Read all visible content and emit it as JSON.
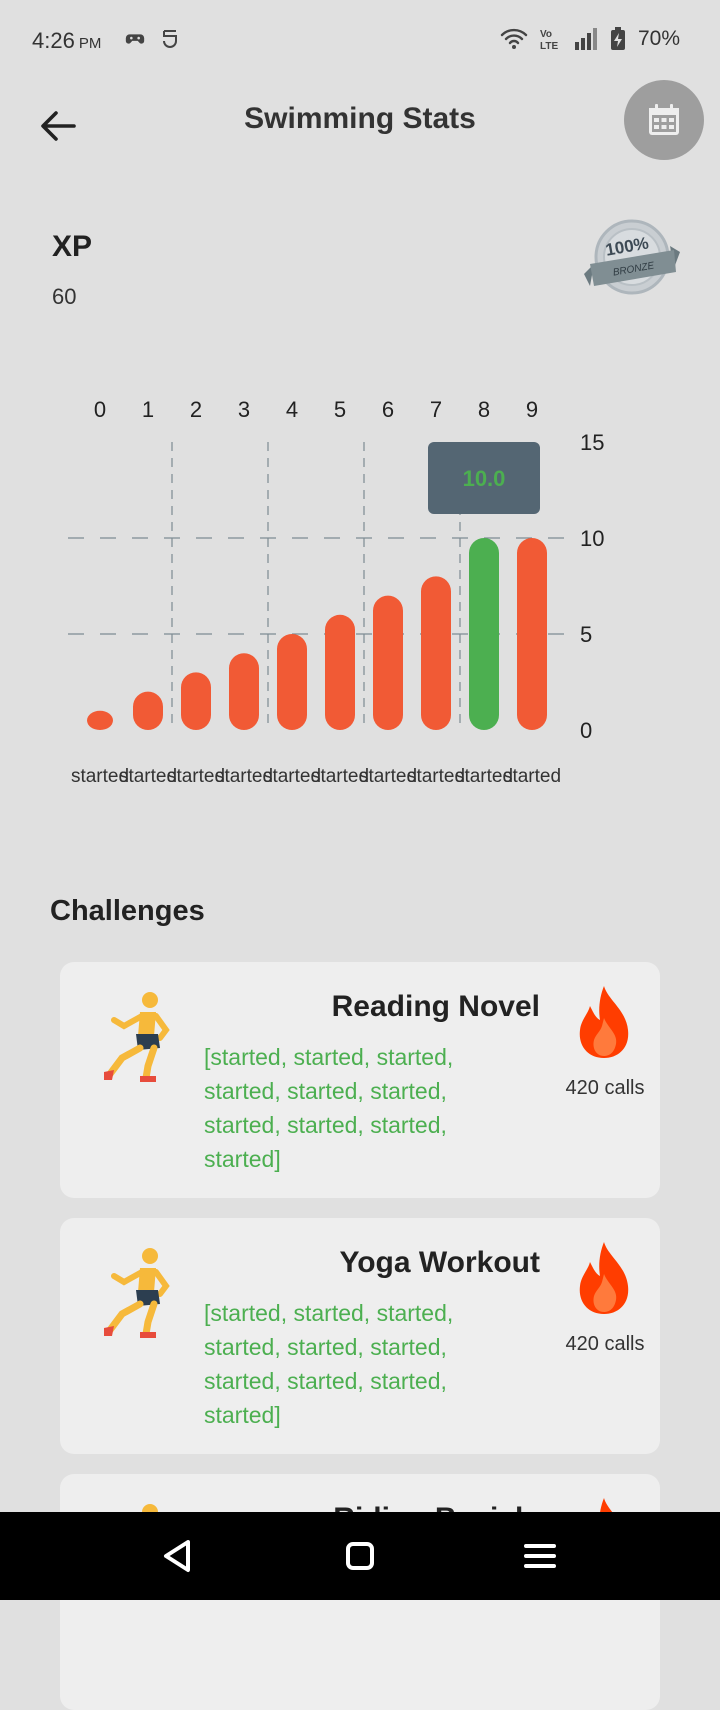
{
  "status": {
    "time": "4:26",
    "ampm": "PM",
    "battery": "70%"
  },
  "header": {
    "title": "Swimming Stats"
  },
  "xp": {
    "label": "XP",
    "value": "60"
  },
  "badge": {
    "top_text": "100%",
    "ribbon_text": "BRONZE"
  },
  "chart_data": {
    "type": "bar",
    "top_labels": [
      "0",
      "1",
      "2",
      "3",
      "4",
      "5",
      "6",
      "7",
      "8",
      "9"
    ],
    "categories": [
      "started",
      "started",
      "started",
      "started",
      "started",
      "started",
      "started",
      "started",
      "started",
      "started"
    ],
    "values": [
      1,
      2,
      3,
      4,
      5,
      6,
      7,
      8,
      10,
      10
    ],
    "y_ticks": [
      "0",
      "5",
      "10",
      "15"
    ],
    "ylim": [
      0,
      15
    ],
    "highlight_index": 8,
    "tooltip": "10.0",
    "colors": {
      "bar": "#f15a35",
      "highlight": "#4caf50",
      "tooltip_bg": "#546673",
      "tooltip_text": "#4caf50"
    }
  },
  "challenges": {
    "title": "Challenges",
    "items": [
      {
        "title": "Reading Novel",
        "desc": "[started, started, started, started, started, started, started, started, started, started]",
        "calls": "420 calls"
      },
      {
        "title": "Yoga Workout",
        "desc": "[started, started, started, started, started, started, started, started, started, started]",
        "calls": "420 calls"
      },
      {
        "title": "Riding Bycicle",
        "desc": "",
        "calls": ""
      }
    ]
  }
}
